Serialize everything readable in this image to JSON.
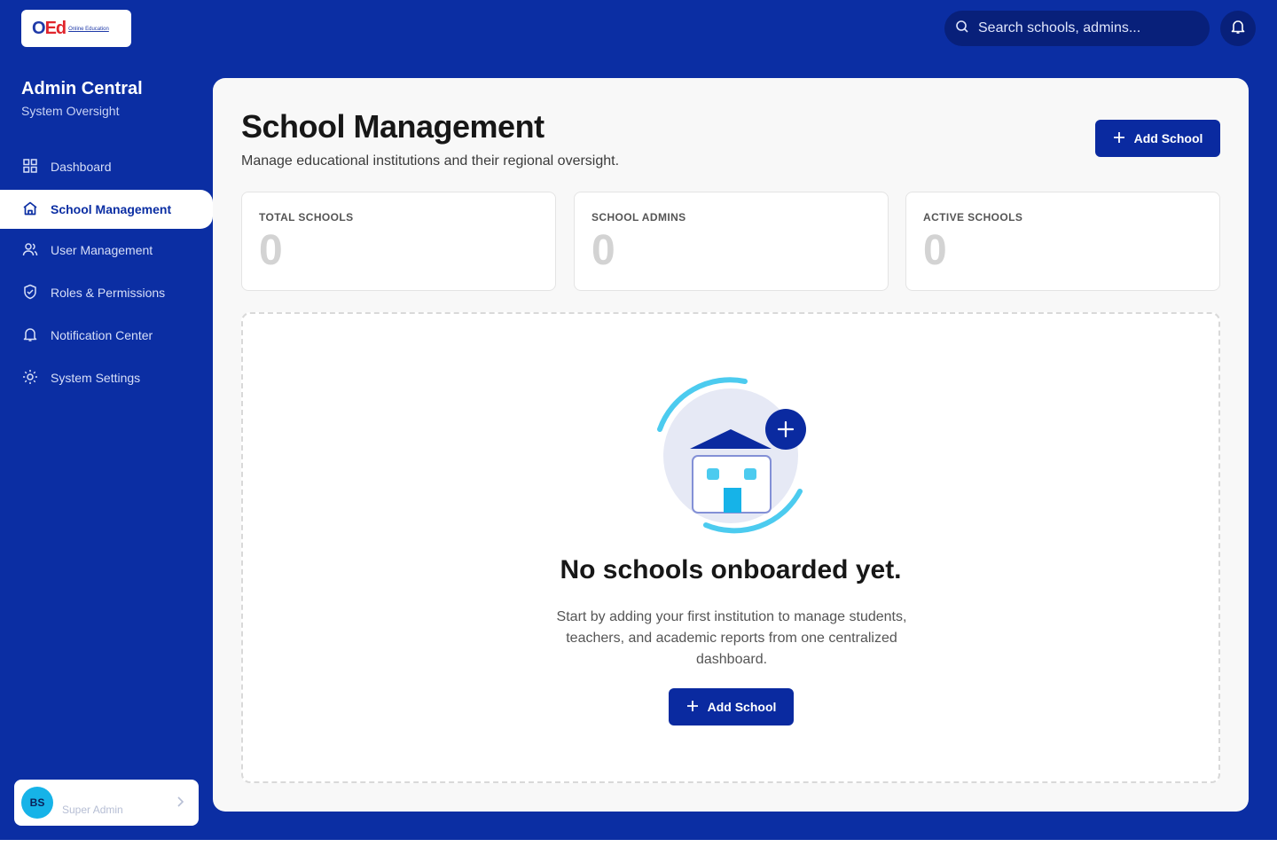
{
  "logo": {
    "mark_o": "O",
    "mark_ed": "Ed",
    "text": "Online Education"
  },
  "topbar": {
    "search_placeholder": "Search schools, admins..."
  },
  "sidebar": {
    "title": "Admin Central",
    "subtitle": "System Oversight",
    "items": [
      {
        "label": "Dashboard",
        "icon": "grid-icon"
      },
      {
        "label": "School Management",
        "icon": "home-icon",
        "active": true
      },
      {
        "label": "User Management",
        "icon": "users-icon"
      },
      {
        "label": "Roles & Permissions",
        "icon": "shield-icon"
      },
      {
        "label": "Notification Center",
        "icon": "bell-icon"
      },
      {
        "label": "System Settings",
        "icon": "gear-icon"
      }
    ],
    "user": {
      "initials": "BS",
      "role": "Super Admin"
    }
  },
  "main": {
    "title": "School Management",
    "subtitle": "Manage educational institutions and their regional oversight.",
    "add_button": "Add School",
    "stats": [
      {
        "label": "TOTAL SCHOOLS",
        "value": "0"
      },
      {
        "label": "SCHOOL ADMINS",
        "value": "0"
      },
      {
        "label": "ACTIVE SCHOOLS",
        "value": "0"
      }
    ],
    "empty": {
      "title": "No schools onboarded yet.",
      "description": "Start by adding your first institution to manage students, teachers, and academic reports from one centralized dashboard.",
      "button": "Add School"
    }
  },
  "colors": {
    "brand": "#0b2ea3",
    "button": "#0a2aa0",
    "accent": "#16b3e8",
    "panel": "#f8f8f8"
  }
}
